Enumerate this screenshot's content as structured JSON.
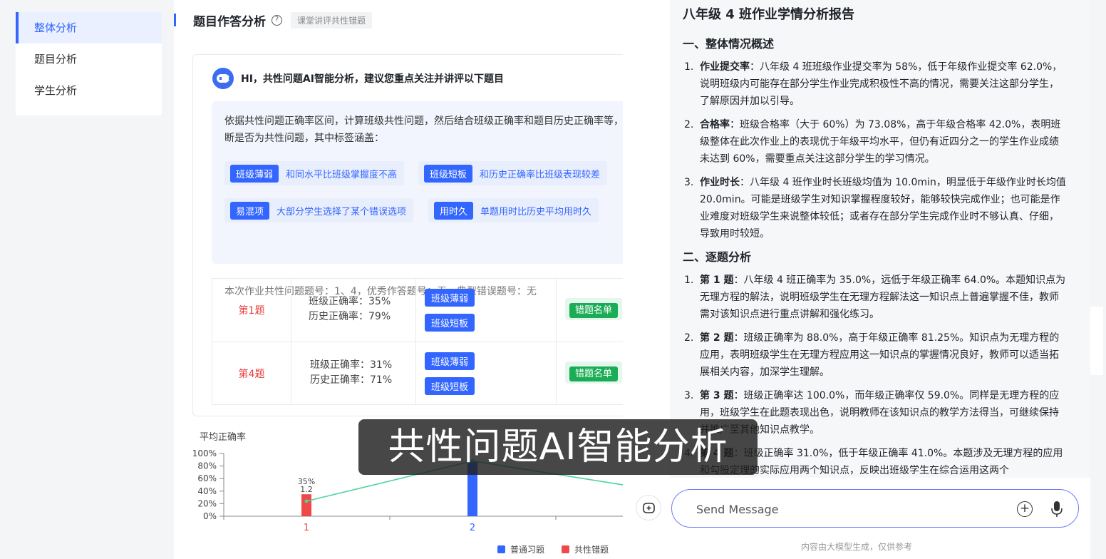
{
  "sidebar": {
    "items": [
      {
        "label": "整体分析"
      },
      {
        "label": "题目分析"
      },
      {
        "label": "学生分析"
      }
    ]
  },
  "section": {
    "title": "题目作答分析",
    "help": "?",
    "tag": "课堂讲评共性错题"
  },
  "ai_card": {
    "title": "HI，共性问题AI智能分析，建议您重点关注并讲评以下题目",
    "desc": "依据共性问题正确率区间，计算班级共性问题，然后结合班级正确率和题目历史正确率等，判断是否为共性问题，其中标签涵盖：",
    "tags": [
      {
        "name": "班级薄弱",
        "desc": "和同水平比班级掌握度不高"
      },
      {
        "name": "班级短板",
        "desc": "和历史正确率比班级表现较差"
      },
      {
        "name": "易混项",
        "desc": "大部分学生选择了某个错误选项"
      },
      {
        "name": "用时久",
        "desc": "单题用时比历史平均用时久"
      }
    ],
    "footer": "本次作业共性问题题号：1、4，优秀作答题号：无，典型错误题号：无"
  },
  "questions": [
    {
      "label": "第1题",
      "class_rate": "班级正确率：35%",
      "hist_rate": "历史正确率：79%",
      "tags": [
        "班级薄弱",
        "班级短板"
      ],
      "action": "错题名单"
    },
    {
      "label": "第4题",
      "class_rate": "班级正确率：31%",
      "hist_rate": "历史正确率：71%",
      "tags": [
        "班级薄弱",
        "班级短板"
      ],
      "action": "错题名单"
    }
  ],
  "chart_data": {
    "type": "bar",
    "title": "",
    "ylabel": "平均正确率",
    "ylim": [
      0,
      100
    ],
    "yticks": [
      "100%",
      "80%",
      "60%",
      "40%",
      "20%",
      "0%"
    ],
    "categories": [
      "1",
      "2"
    ],
    "series": [
      {
        "name": "普通习题",
        "color": "#3366ff",
        "values": [
          null,
          88
        ]
      },
      {
        "name": "共性错题",
        "color": "#f04848",
        "values": [
          35,
          null
        ]
      }
    ],
    "line": {
      "color": "#4cd49a",
      "values": [
        24,
        88
      ]
    },
    "labels": [
      "35%",
      "1.2"
    ],
    "legend_position": "bottom"
  },
  "report": {
    "title": "八年级 4 班作业学情分析报告",
    "sections": [
      {
        "heading": "一、整体情况概述",
        "items": [
          {
            "num": "1.",
            "lead": "作业提交率",
            "text": "：八年级 4 班班级作业提交率为 58%，低于年级作业提交率 62.0%，说明班级内可能存在部分学生作业完成积极性不高的情况，需要关注这部分学生，了解原因并加以引导。"
          },
          {
            "num": "2.",
            "lead": "合格率",
            "text": "：班级合格率（大于 60%）为 73.08%，高于年级合格率 42.0%，表明班级整体在此次作业上的表现优于年级平均水平，但仍有近四分之一的学生作业成绩未达到 60%，需要重点关注这部分学生的学习情况。"
          },
          {
            "num": "3.",
            "lead": "作业时长",
            "text": "：八年级 4 班作业时长班级均值为 10.0min，明显低于年级作业时长均值 20.0min。可能是班级学生对知识掌握程度较好，能够较快完成作业；也可能是作业难度对班级学生来说整体较低；或者存在部分学生完成作业时不够认真、仔细，导致用时较短。"
          }
        ]
      },
      {
        "heading": "二、逐题分析",
        "items": [
          {
            "num": "1.",
            "lead": "第 1 题",
            "text": "：八年级 4 班正确率为 35.0%，远低于年级正确率 64.0%。本题知识点为无理方程的解法，说明班级学生在无理方程解法这一知识点上普遍掌握不佳，教师需对该知识点进行重点讲解和强化练习。"
          },
          {
            "num": "2.",
            "lead": "第 2 题",
            "text": "：班级正确率为 88.0%，高于年级正确率 81.25%。知识点为无理方程的应用，表明班级学生在无理方程应用这一知识点的掌握情况良好，教师可以适当拓展相关内容，加深学生理解。"
          },
          {
            "num": "3.",
            "lead": "第 3 题",
            "text": "：班级正确率达 100.0%，而年级正确率仅 59.0%。同样是无理方程的应用，班级学生在此题表现出色，说明教师在该知识点的教学方法得当，可继续保持并推广至其他知识点教学。"
          },
          {
            "num": "4.",
            "lead": "第 4 题",
            "text": "：班级正确率 31.0%，低于年级正确率 41.0%。本题涉及无理方程的应用和勾股定理的实际应用两个知识点，反映出班级学生在综合运用这两个"
          }
        ]
      }
    ]
  },
  "chat": {
    "placeholder": "Send Message",
    "footnote": "内容由大模型生成，仅供参考",
    "scroll_glyph": "↓",
    "plus_glyph": "+"
  },
  "subtitle": "共性问题AI智能分析"
}
